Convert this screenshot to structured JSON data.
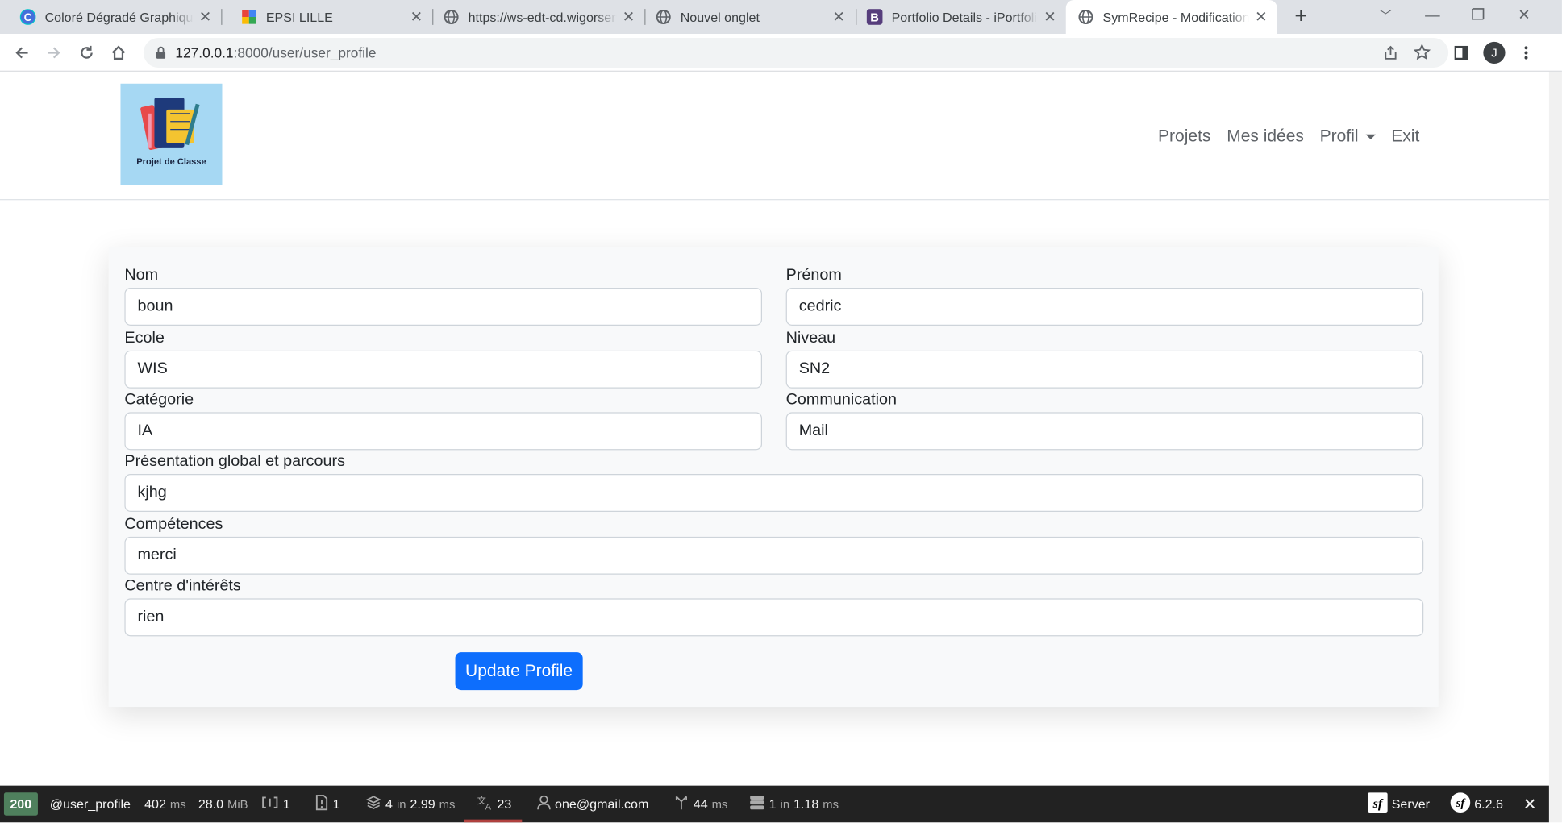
{
  "browser": {
    "tabs": [
      {
        "title": "Coloré Dégradé Graphique",
        "icon": "canva-icon",
        "icon_color": "#00c4cc"
      },
      {
        "title": "EPSI LILLE",
        "icon": "epsi-icon",
        "icon_color": "#e8453c"
      },
      {
        "title": "https://ws-edt-cd.wigorservices",
        "icon": "globe-icon",
        "icon_color": "#5f6368"
      },
      {
        "title": "Nouvel onglet",
        "icon": "globe-icon",
        "icon_color": "#5f6368"
      },
      {
        "title": "Portfolio Details - iPortfolio",
        "icon": "bootstrap-icon",
        "icon_color": "#563d7c"
      },
      {
        "title": "SymRecipe - Modification du profil",
        "icon": "globe-icon",
        "icon_color": "#5f6368"
      }
    ],
    "url_host": "127.0.0.1",
    "url_path": ":8000/user/user_profile",
    "profile_initial": "J"
  },
  "site": {
    "logo_text": "Projet de Classe",
    "nav": {
      "projects": "Projets",
      "ideas": "Mes idées",
      "profile": "Profil",
      "exit": "Exit"
    }
  },
  "form": {
    "nom": {
      "label": "Nom",
      "value": "boun"
    },
    "prenom": {
      "label": "Prénom",
      "value": "cedric"
    },
    "ecole": {
      "label": "Ecole",
      "value": "WIS"
    },
    "niveau": {
      "label": "Niveau",
      "value": "SN2"
    },
    "categorie": {
      "label": "Catégorie",
      "value": "IA"
    },
    "communication": {
      "label": "Communication",
      "value": "Mail"
    },
    "presentation": {
      "label": "Présentation global et parcours",
      "value": "kjhg"
    },
    "competences": {
      "label": "Compétences",
      "value": "merci"
    },
    "interets": {
      "label": "Centre d'intérêts",
      "value": "rien"
    },
    "submit": "Update Profile"
  },
  "symfony_toolbar": {
    "status": "200",
    "route": "@user_profile",
    "time_value": "402",
    "time_unit": "ms",
    "memory_value": "28.0",
    "memory_unit": "MiB",
    "logs": "1",
    "errors": "1",
    "templates_count": "4",
    "templates_in": "in",
    "templates_time": "2.99",
    "templates_unit": "ms",
    "translations": "23",
    "user": "one@gmail.com",
    "events_time": "44",
    "events_unit": "ms",
    "db_count": "1",
    "db_in": "in",
    "db_time": "1.18",
    "db_unit": "ms",
    "server": "Server",
    "version": "6.2.6",
    "accent_color": "#4f805d"
  }
}
